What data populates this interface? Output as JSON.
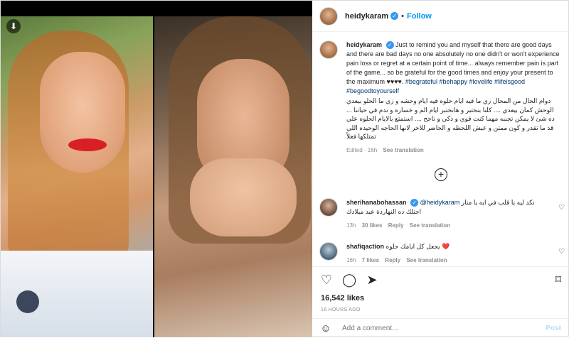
{
  "header": {
    "username": "heidykaram",
    "dot": "•",
    "follow_label": "Follow"
  },
  "caption": {
    "username": "heidykaram",
    "text_en": "Just to remind you and myself that there are good days and there are bad days no one absolutely no one didn't or won't experience pain loss or regret at a certain point of time... always remember pain is part of the game... so be grateful for the good times and enjoy your present to the maximum ♥♥♥♥.",
    "hashtags": "#begrateful #behappy #lovelife #lifeisgood #begoodtoyourself",
    "text_ar": "دوام الحال من المحال زي ما فيه ايام حلوه فيه ايام وحشه و زي ما الحلو بيعدي الوحش كمان بيعدي .... كلنا بنختبر و هانختبر ايام الم و خساره و ندم في حياتنا ... ده شئ لا يمكن تجنبه مهما كنت قوي و ذكي و ناجح .... استمتع بالايام الحلوه علي قد ما تقدر و كون ممتن و عيش اللحظه و الحاضر للاخر لانها الحاجه الوحيده اللي تمتلكها فعلاً",
    "edited": "Edited · 16h",
    "see_translation": "See translation"
  },
  "comments": [
    {
      "username": "sherihanabohassan",
      "mention": "@heidykaram",
      "text": "نكد ليه يا قلب في ايه يا منار",
      "text2": "احتلك ده النهاردة عيد ميلادك",
      "time": "13h",
      "likes": "30 likes",
      "reply": "Reply",
      "see_translation": "See translation"
    },
    {
      "username": "shafiqaction",
      "text": "يجعل كل ايامك حلوه ❤️",
      "time": "16h",
      "likes": "7 likes",
      "reply": "Reply",
      "see_translation": "See translation"
    }
  ],
  "actions": {
    "likes": "16,542 likes",
    "time_ago": "16 HOURS AGO",
    "comment_placeholder": "Add a comment...",
    "post_label": "Post"
  },
  "icons": {
    "download": "download-icon",
    "like": "heart-icon",
    "comment": "comment-icon",
    "share": "share-icon",
    "save": "bookmark-icon",
    "emoji": "emoji-icon",
    "load_more": "plus-circle-icon"
  },
  "colors": {
    "link": "#0095f6",
    "hashtag": "#00376b",
    "muted": "#8e8e8e"
  }
}
